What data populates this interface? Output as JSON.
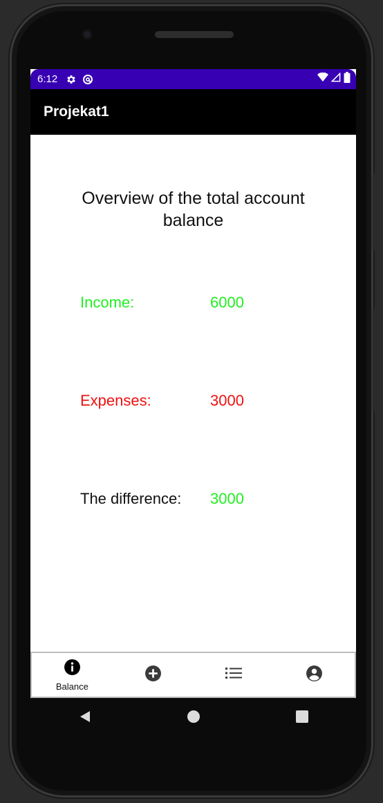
{
  "status_bar": {
    "time": "6:12",
    "icons": [
      "gear-icon",
      "at-sign-icon",
      "wifi-icon",
      "signal-icon",
      "battery-icon"
    ]
  },
  "app_bar": {
    "title": "Projekat1"
  },
  "main": {
    "title": "Overview of the total account balance",
    "rows": [
      {
        "label": "Income:",
        "value": "6000",
        "color": "#22ee22"
      },
      {
        "label": "Expenses:",
        "value": "3000",
        "color": "#ee1111"
      },
      {
        "label": "The difference:",
        "value": "3000",
        "label_color": "#111111",
        "value_color": "#22ee22"
      }
    ]
  },
  "bottom_nav": {
    "items": [
      {
        "icon": "info-icon",
        "label": "Balance",
        "selected": true
      },
      {
        "icon": "add-circle-icon",
        "label": ""
      },
      {
        "icon": "list-icon",
        "label": ""
      },
      {
        "icon": "account-circle-icon",
        "label": ""
      }
    ]
  },
  "system_nav": {
    "icons": [
      "back-icon",
      "home-icon",
      "recents-icon"
    ]
  },
  "colors": {
    "status_bar": "#3700b3",
    "app_bar": "#000000",
    "positive": "#22ee22",
    "negative": "#ee1111"
  }
}
